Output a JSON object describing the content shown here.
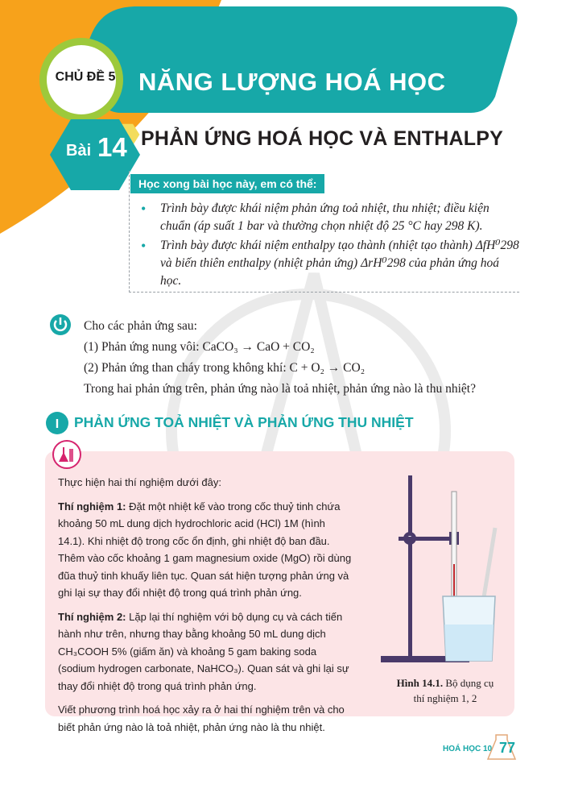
{
  "header": {
    "chapter_label": "CHỦ ĐỀ 5",
    "chapter_title": "NĂNG LƯỢNG HOÁ HỌC",
    "lesson_word": "Bài",
    "lesson_number": "14",
    "lesson_title": "PHẢN ỨNG HOÁ HỌC VÀ ENTHALPY"
  },
  "objectives": {
    "heading": "Học xong bài học này, em có thể:",
    "items": [
      "Trình bày được khái niệm phản ứng toả nhiệt, thu nhiệt; điều kiện chuẩn (áp suất 1 bar và thường chọn nhiệt độ 25 °C hay 298 K).",
      "Trình bày được khái niệm enthalpy tạo thành (nhiệt tạo thành) ΔfH⁰298 và biến thiên enthalpy (nhiệt phản ứng) ΔrH⁰298 của phản ứng hoá học."
    ]
  },
  "warmup": {
    "intro": "Cho các phản ứng sau:",
    "reaction1": "(1) Phản ứng nung vôi: CaCO₃ → CaO + CO₂",
    "reaction2": "(2) Phản ứng than cháy trong không khí: C + O₂ → CO₂",
    "question": "Trong hai phản ứng trên, phản ứng nào là toả nhiệt, phản ứng nào là thu nhiệt?"
  },
  "section": {
    "number": "I",
    "title": "PHẢN ỨNG TOẢ NHIỆT VÀ PHẢN ỨNG THU NHIỆT"
  },
  "experiment": {
    "intro": "Thực hiện hai thí nghiệm dưới đây:",
    "exp1_label": "Thí nghiệm 1:",
    "exp1_text": "Đặt một nhiệt kế vào trong cốc thuỷ tinh chứa khoảng 50 mL dung dịch hydrochloric acid (HCl) 1M (hình 14.1). Khi nhiệt độ trong cốc ổn định, ghi nhiệt độ ban đầu. Thêm vào cốc khoảng 1 gam magnesium oxide (MgO) rồi dùng đũa thuỷ tinh khuấy liên tục. Quan sát hiện tượng phản ứng và ghi lại sự thay đổi nhiệt độ trong quá trình phản ứng.",
    "exp2_label": "Thí nghiệm 2:",
    "exp2_text": "Lặp lại thí nghiệm với bộ dụng cụ và cách tiến hành như trên, nhưng thay bằng khoảng 50 mL dung dịch CH₃COOH 5% (giấm ăn) và khoảng 5 gam baking soda (sodium hydrogen carbonate, NaHCO₃). Quan sát và ghi lại sự thay đổi nhiệt độ trong quá trình phản ứng.",
    "task": "Viết phương trình hoá học xảy ra ở hai thí nghiệm trên và cho biết phản ứng nào là toả nhiệt, phản ứng nào là thu nhiệt.",
    "figure_label": "Hình 14.1.",
    "figure_caption": "Bộ dụng cụ thí nghiệm 1, 2"
  },
  "footer": {
    "subject": "HOÁ HỌC 10",
    "page_number": "77"
  },
  "colors": {
    "teal": "#17a8a8",
    "orange": "#f7a21b",
    "green": "#9dc93b",
    "pink_panel": "#fce4e6",
    "magenta": "#d6246e"
  }
}
